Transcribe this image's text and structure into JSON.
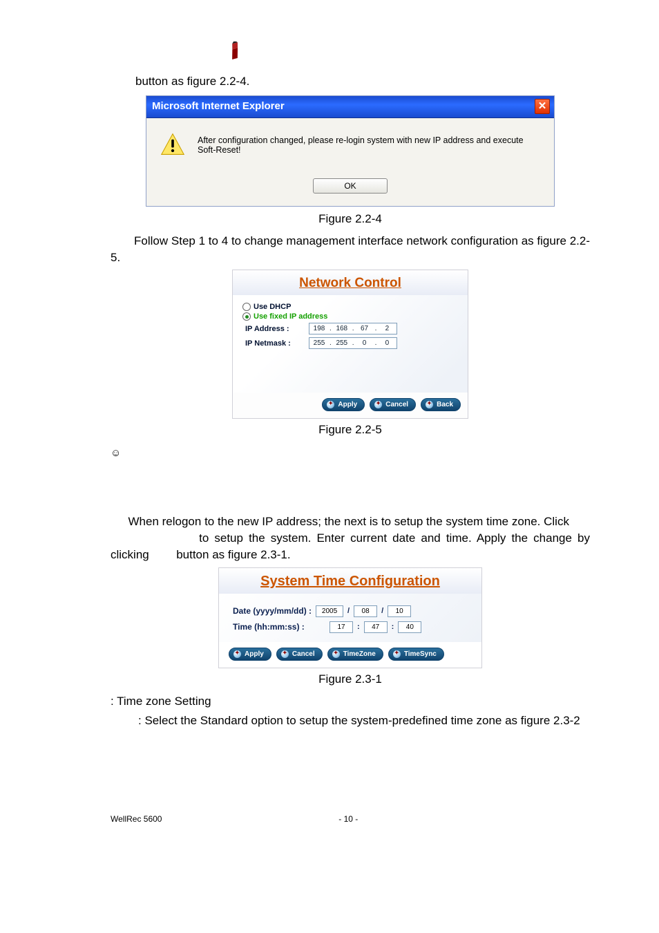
{
  "top_para": "button as figure 2.2-4.",
  "dialog": {
    "title": "Microsoft Internet Explorer",
    "msg": "After configuration changed, please re-login system with new IP address and execute Soft-Reset!",
    "ok": "OK"
  },
  "cap224": "Figure 2.2-4",
  "para2": "Follow Step 1 to 4 to change management interface network configuration as figure 2.2-5.",
  "net": {
    "title": "Network Control",
    "useDhcp": "Use DHCP",
    "useFixed": "Use fixed IP address",
    "ipLbl": "IP Address :",
    "maskLbl": "IP Netmask :",
    "ip": [
      "198",
      "168",
      "67",
      "2"
    ],
    "mask": [
      "255",
      "255",
      "0",
      "0"
    ],
    "apply": "Apply",
    "cancel": "Cancel",
    "back": "Back"
  },
  "cap225": "Figure 2.2-5",
  "smile": "☺",
  "para3a": "When relogon to the new IP address; the next is to setup the system time zone. Click ",
  "para3b": " to setup the system. Enter current date and time. Apply the change by clicking ",
  "para3c": " button as figure 2.3-1.",
  "sys": {
    "title": "System Time Configuration",
    "dateLbl": "Date (yyyy/mm/dd) :",
    "timeLbl": "Time (hh:mm:ss) :",
    "date": [
      "2005",
      "08",
      "10"
    ],
    "time": [
      "17",
      "47",
      "40"
    ],
    "apply": "Apply",
    "cancel": "Cancel",
    "tz": "TimeZone",
    "ts": "TimeSync"
  },
  "cap231": "Figure 2.3-1",
  "tz_label": ": Time zone Setting",
  "tz_desc": ": Select the Standard option to setup the system-predefined time zone as figure 2.3-2",
  "footer": {
    "left": "WellRec 5600",
    "right": "- 10 -"
  }
}
